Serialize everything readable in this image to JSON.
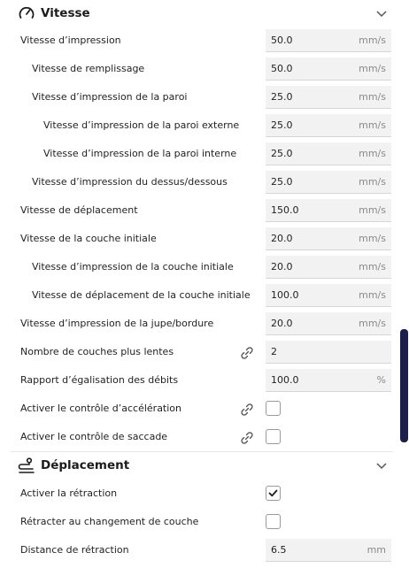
{
  "sections": {
    "speed": {
      "title": "Vitesse",
      "icon": "speedometer-icon"
    },
    "travel": {
      "title": "Déplacement",
      "icon": "travel-icon"
    }
  },
  "rows": [
    {
      "label": "Vitesse d’impression",
      "value": "50.0",
      "unit": "mm/s"
    },
    {
      "label": "Vitesse de remplissage",
      "value": "50.0",
      "unit": "mm/s"
    },
    {
      "label": "Vitesse d’impression de la paroi",
      "value": "25.0",
      "unit": "mm/s"
    },
    {
      "label": "Vitesse d’impression de la paroi externe",
      "value": "25.0",
      "unit": "mm/s"
    },
    {
      "label": "Vitesse d’impression de la paroi interne",
      "value": "25.0",
      "unit": "mm/s"
    },
    {
      "label": "Vitesse d’impression du dessus/dessous",
      "value": "25.0",
      "unit": "mm/s"
    },
    {
      "label": "Vitesse de déplacement",
      "value": "150.0",
      "unit": "mm/s"
    },
    {
      "label": "Vitesse de la couche initiale",
      "value": "20.0",
      "unit": "mm/s"
    },
    {
      "label": "Vitesse d’impression de la couche initiale",
      "value": "20.0",
      "unit": "mm/s"
    },
    {
      "label": "Vitesse de déplacement de la couche initiale",
      "value": "100.0",
      "unit": "mm/s"
    },
    {
      "label": "Vitesse d’impression de la jupe/bordure",
      "value": "20.0",
      "unit": "mm/s"
    },
    {
      "label": "Nombre de couches plus lentes",
      "value": "2",
      "unit": ""
    },
    {
      "label": "Rapport d’égalisation des débits",
      "value": "100.0",
      "unit": "%"
    },
    {
      "label": "Activer le contrôle d’accélération",
      "checked": false
    },
    {
      "label": "Activer le contrôle de saccade",
      "checked": false
    },
    {
      "label": "Activer la rétraction",
      "checked": true
    },
    {
      "label": "Rétracter au changement de couche",
      "checked": false
    },
    {
      "label": "Distance de rétraction",
      "value": "6.5",
      "unit": "mm"
    }
  ],
  "colors": {
    "accent": "#1b1f4a",
    "field_bg": "#f2f2f2"
  }
}
